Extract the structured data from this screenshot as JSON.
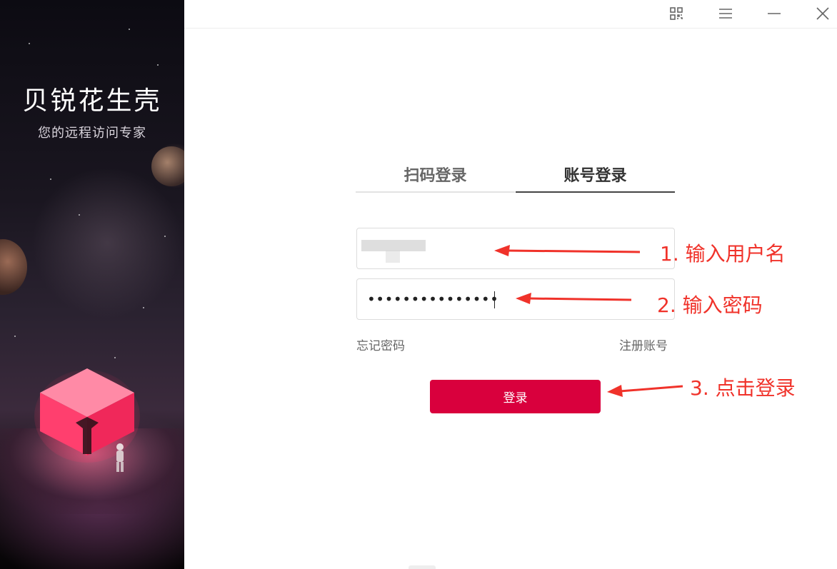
{
  "window": {
    "controls": [
      "qr-code-icon",
      "menu-icon",
      "minimize-icon",
      "close-icon"
    ]
  },
  "side": {
    "title": "贝锐花生壳",
    "subtitle": "您的远程访问专家"
  },
  "tabs": [
    {
      "label": "扫码登录",
      "active": false
    },
    {
      "label": "账号登录",
      "active": true
    }
  ],
  "form": {
    "username_value": "",
    "password_dots": "•••••••••••••••",
    "forgot_password": "忘记密码",
    "register": "注册账号",
    "login_button": "登录"
  },
  "annotations": {
    "step1": "1. 输入用户名",
    "step2": "2. 输入密码",
    "step3": "3. 点击登录"
  },
  "colors": {
    "brand": "#d9003d",
    "annotation": "#f0322a"
  }
}
